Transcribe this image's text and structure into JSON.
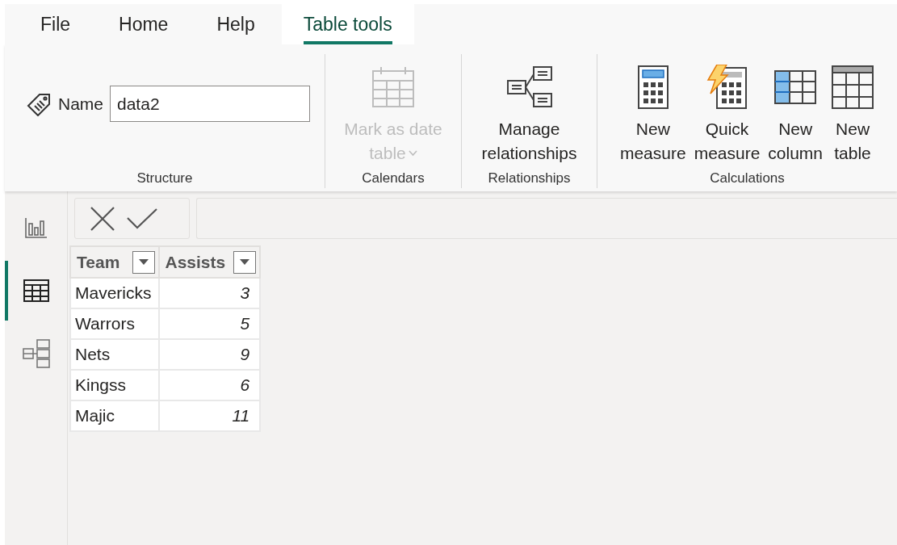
{
  "menu_tabs": [
    {
      "label": "File",
      "selected": false
    },
    {
      "label": "Home",
      "selected": false
    },
    {
      "label": "Help",
      "selected": false
    },
    {
      "label": "Table tools",
      "selected": true
    }
  ],
  "ribbon_groups": [
    {
      "label": "Structure",
      "items": [
        {
          "kind": "field",
          "label": "Name",
          "value": "data2"
        }
      ]
    },
    {
      "label": "Calendars",
      "items": [
        {
          "kind": "button",
          "lines": [
            "Mark as date",
            "table"
          ],
          "dropdown": true,
          "disabled": true
        }
      ]
    },
    {
      "label": "Relationships",
      "items": [
        {
          "kind": "button",
          "lines": [
            "Manage",
            "relationships"
          ],
          "dropdown": false,
          "disabled": false
        }
      ]
    },
    {
      "label": "Calculations",
      "items": [
        {
          "kind": "button",
          "lines": [
            "New",
            "measure"
          ],
          "dropdown": false,
          "disabled": false
        },
        {
          "kind": "button",
          "lines": [
            "Quick",
            "measure"
          ],
          "dropdown": false,
          "disabled": false
        },
        {
          "kind": "button",
          "lines": [
            "New",
            "column"
          ],
          "dropdown": false,
          "disabled": false
        },
        {
          "kind": "button",
          "lines": [
            "New",
            "table"
          ],
          "dropdown": false,
          "disabled": false
        }
      ]
    }
  ],
  "views": [
    {
      "selected": false
    },
    {
      "selected": true
    },
    {
      "selected": false
    }
  ],
  "table": {
    "columns": [
      "Team",
      "Assists"
    ],
    "rows": [
      [
        "Mavericks",
        "3"
      ],
      [
        "Warrors",
        "5"
      ],
      [
        "Nets",
        "9"
      ],
      [
        "Kingss",
        "6"
      ],
      [
        "Majic",
        "11"
      ]
    ]
  }
}
